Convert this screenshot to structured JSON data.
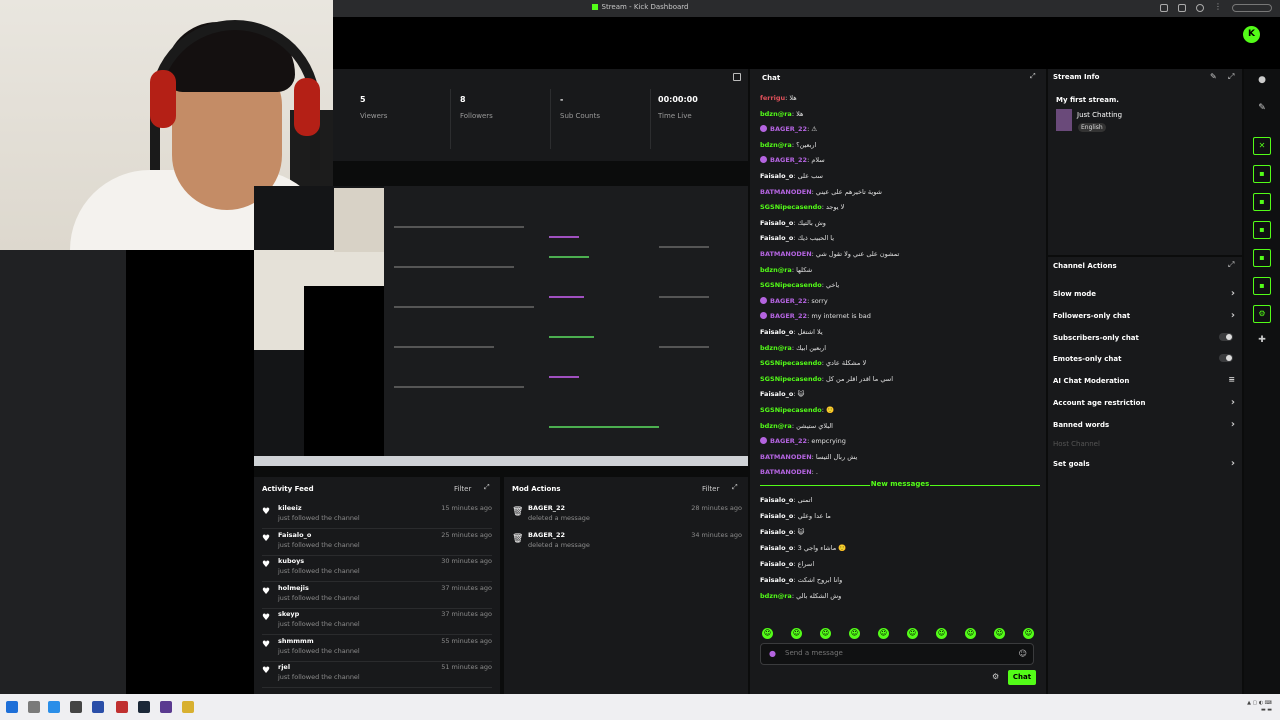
{
  "window": {
    "title": "Stream - Kick Dashboard"
  },
  "stats": [
    {
      "value": "5",
      "label": "Viewers"
    },
    {
      "value": "8",
      "label": "Followers"
    },
    {
      "value": "-",
      "label": "Sub Counts"
    },
    {
      "value": "00:00:00",
      "label": "Time Live"
    }
  ],
  "activity_feed": {
    "title": "Activity Feed",
    "filter_label": "Filter",
    "items": [
      {
        "name": "kileeiz",
        "sub": "just followed the channel",
        "time": "15 minutes ago"
      },
      {
        "name": "Faisalo_o",
        "sub": "just followed the channel",
        "time": "25 minutes ago"
      },
      {
        "name": "kuboys",
        "sub": "just followed the channel",
        "time": "30 minutes ago"
      },
      {
        "name": "holmejis",
        "sub": "just followed the channel",
        "time": "37 minutes ago"
      },
      {
        "name": "skeyp",
        "sub": "just followed the channel",
        "time": "37 minutes ago"
      },
      {
        "name": "shmmmm",
        "sub": "just followed the channel",
        "time": "55 minutes ago"
      },
      {
        "name": "rjel",
        "sub": "just followed the channel",
        "time": "51 minutes ago"
      }
    ]
  },
  "mod_actions": {
    "title": "Mod Actions",
    "filter_label": "Filter",
    "items": [
      {
        "name": "BAGER_22",
        "sub": "deleted a message",
        "time": "28 minutes ago"
      },
      {
        "name": "BAGER_22",
        "sub": "deleted a message",
        "time": "34 minutes ago"
      }
    ]
  },
  "chat": {
    "title": "Chat",
    "new_messages_label": "New messages",
    "input_placeholder": "Send a message",
    "send_label": "Chat",
    "messages": [
      {
        "user": "ferrigu",
        "text": "هلا",
        "color": "#e0505a",
        "badge": false
      },
      {
        "user": "bdzn@ra",
        "text": "هلا",
        "color": "#53fc18",
        "badge": false
      },
      {
        "user": "BAGER_22",
        "text": "⚠",
        "color": "#b464e0",
        "badge": true
      },
      {
        "user": "bdzn@ra",
        "text": "اربعين؟",
        "color": "#53fc18",
        "badge": false
      },
      {
        "user": "BAGER_22",
        "text": "سلام",
        "color": "#b464e0",
        "badge": true
      },
      {
        "user": "Faisalo_o",
        "text": "سب على",
        "color": "#ffffff",
        "badge": false
      },
      {
        "user": "BATMANODEN",
        "text": "شوية تاخيرهم على عيني",
        "color": "#b464e0",
        "badge": false
      },
      {
        "user": "SGSNipecasendo",
        "text": "لا يوجد",
        "color": "#53fc18",
        "badge": false
      },
      {
        "user": "Faisalo_o",
        "text": "وش بالتيك",
        "color": "#ffffff",
        "badge": false
      },
      {
        "user": "Faisalo_o",
        "text": "يا الحبيب ذيك",
        "color": "#ffffff",
        "badge": false
      },
      {
        "user": "BATMANODEN",
        "text": "تمشون على عني ولا تقول شي",
        "color": "#b464e0",
        "badge": false
      },
      {
        "user": "bdzn@ra",
        "text": "شكلها",
        "color": "#53fc18",
        "badge": false
      },
      {
        "user": "SGSNipecasendo",
        "text": "ياخي",
        "color": "#53fc18",
        "badge": false
      },
      {
        "user": "BAGER_22",
        "text": "sorry",
        "color": "#b464e0",
        "badge": true
      },
      {
        "user": "BAGER_22",
        "text": "my internet is bad",
        "color": "#b464e0",
        "badge": true
      },
      {
        "user": "Faisalo_o",
        "text": "يلا اشتغل",
        "color": "#ffffff",
        "badge": false
      },
      {
        "user": "bdzn@ra",
        "text": "اربعين ابيك",
        "color": "#53fc18",
        "badge": false
      },
      {
        "user": "SGSNipecasendo",
        "text": "لا مشكلة عادي",
        "color": "#53fc18",
        "badge": false
      },
      {
        "user": "SGSNipecasendo",
        "text": "اسي ما اقدر اقلر من كل",
        "color": "#53fc18",
        "badge": false
      },
      {
        "user": "Faisalo_o",
        "text": "😺",
        "color": "#ffffff",
        "badge": false
      },
      {
        "user": "SGSNipecasendo",
        "text": "🙂",
        "color": "#53fc18",
        "badge": false
      },
      {
        "user": "bdzn@ra",
        "text": "البلاي ستيشن",
        "color": "#53fc18",
        "badge": false
      },
      {
        "user": "BAGER_22",
        "text": "empcrying",
        "color": "#b464e0",
        "badge": true
      },
      {
        "user": "BATMANODEN",
        "text": "يش ربال التيسا",
        "color": "#b464e0",
        "badge": false
      },
      {
        "user": "BATMANODEN",
        "text": ".",
        "color": "#b464e0",
        "badge": false
      },
      {
        "user": "Faisalo_o",
        "text": "اتمنى",
        "color": "#ffffff",
        "badge": false
      },
      {
        "user": "Faisalo_o",
        "text": "ما عدا وعلي",
        "color": "#ffffff",
        "badge": false
      },
      {
        "user": "Faisalo_o",
        "text": "😺",
        "color": "#ffffff",
        "badge": false
      },
      {
        "user": "Faisalo_o",
        "text": "3 ماشاء واجي 🙂",
        "color": "#ffffff",
        "badge": false
      },
      {
        "user": "Faisalo_o",
        "text": "اسراع",
        "color": "#ffffff",
        "badge": false
      },
      {
        "user": "Faisalo_o",
        "text": "وانا ابروح اشكت",
        "color": "#ffffff",
        "badge": false
      },
      {
        "user": "bdzn@ra",
        "text": "وش الشكله بالي",
        "color": "#53fc18",
        "badge": false
      }
    ]
  },
  "stream_info": {
    "title": "Stream Info",
    "stream_title": "My first stream.",
    "category": "Just Chatting",
    "language": "English"
  },
  "channel_actions": {
    "title": "Channel Actions",
    "items": [
      {
        "label": "Slow mode",
        "kind": "chevron"
      },
      {
        "label": "Followers-only chat",
        "kind": "chevron"
      },
      {
        "label": "Subscribers-only chat",
        "kind": "toggle"
      },
      {
        "label": "Emotes-only chat",
        "kind": "toggle"
      },
      {
        "label": "AI Chat Moderation",
        "kind": "icon"
      },
      {
        "label": "Account age restriction",
        "kind": "chevron"
      },
      {
        "label": "Banned words",
        "kind": "chevron"
      },
      {
        "label": "Host Channel",
        "kind": "disabled"
      },
      {
        "label": "Set goals",
        "kind": "chevron"
      }
    ]
  },
  "colors": {
    "accent": "#53fc18",
    "panel": "#18191b",
    "background": "#0b0c0c"
  },
  "icons": [
    "kick-logo-icon",
    "expand-icon",
    "heart-icon",
    "trash-icon",
    "edit-icon",
    "chevron-right-icon",
    "send-icon",
    "settings-icon",
    "microphone-icon"
  ]
}
